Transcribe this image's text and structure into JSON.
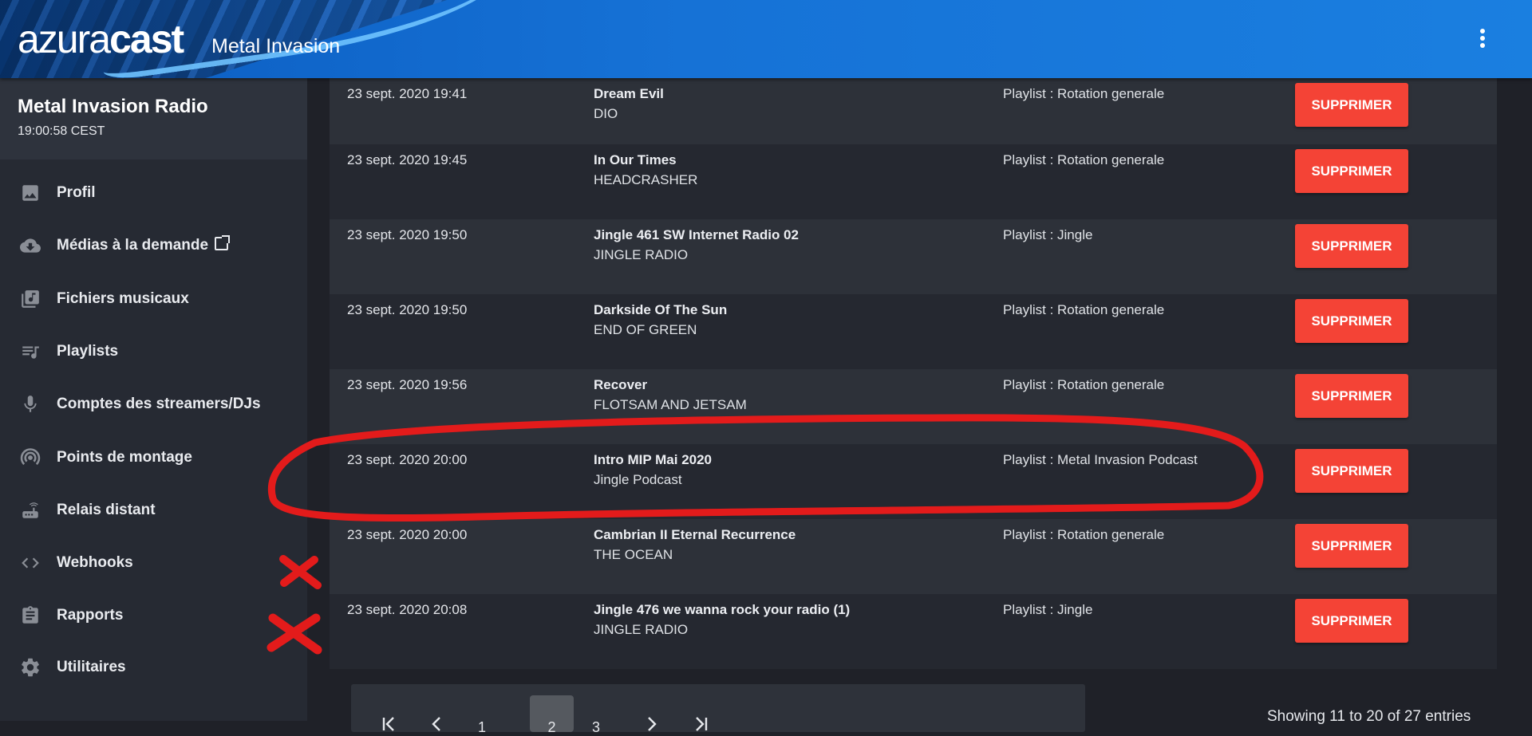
{
  "header": {
    "logo_light": "azura",
    "logo_bold": "cast",
    "station_title": "Metal Invasion"
  },
  "sidebar": {
    "station_name": "Metal Invasion Radio",
    "station_time": "19:00:58 CEST",
    "items": [
      {
        "label": "Profil",
        "icon": "image-icon"
      },
      {
        "label": "Médias à la demande",
        "icon": "cloud-download-icon",
        "external": true
      },
      {
        "label": "Fichiers musicaux",
        "icon": "library-music-icon"
      },
      {
        "label": "Playlists",
        "icon": "queue-music-icon"
      },
      {
        "label": "Comptes des streamers/DJs",
        "icon": "mic-icon"
      },
      {
        "label": "Points de montage",
        "icon": "podcast-icon"
      },
      {
        "label": "Relais distant",
        "icon": "router-icon"
      },
      {
        "label": "Webhooks",
        "icon": "code-icon"
      },
      {
        "label": "Rapports",
        "icon": "assignment-icon"
      },
      {
        "label": "Utilitaires",
        "icon": "settings-icon"
      }
    ]
  },
  "queue": {
    "delete_label": "SUPPRIMER",
    "rows": [
      {
        "date": "23 sept. 2020 19:41",
        "title": "Dream Evil",
        "artist": "DIO",
        "playlist": "Playlist : Rotation generale"
      },
      {
        "date": "23 sept. 2020 19:45",
        "title": "In Our Times",
        "artist": "HEADCRASHER",
        "playlist": "Playlist : Rotation generale"
      },
      {
        "date": "23 sept. 2020 19:50",
        "title": "Jingle 461 SW Internet Radio 02",
        "artist": "JINGLE RADIO",
        "playlist": "Playlist : Jingle"
      },
      {
        "date": "23 sept. 2020 19:50",
        "title": "Darkside Of The Sun",
        "artist": "END OF GREEN",
        "playlist": "Playlist : Rotation generale"
      },
      {
        "date": "23 sept. 2020 19:56",
        "title": "Recover",
        "artist": "FLOTSAM AND JETSAM",
        "playlist": "Playlist : Rotation generale"
      },
      {
        "date": "23 sept. 2020 20:00",
        "title": "Intro MIP Mai 2020",
        "artist": "Jingle Podcast",
        "playlist": "Playlist : Metal Invasion Podcast"
      },
      {
        "date": "23 sept. 2020 20:00",
        "title": "Cambrian II Eternal Recurrence",
        "artist": "THE OCEAN",
        "playlist": "Playlist : Rotation generale"
      },
      {
        "date": "23 sept. 2020 20:08",
        "title": "Jingle 476 we wanna rock your radio (1)",
        "artist": "JINGLE RADIO",
        "playlist": "Playlist : Jingle"
      }
    ]
  },
  "pagination": {
    "pages": [
      "1",
      "2",
      "3"
    ],
    "current_page": "2",
    "entries_text": "Showing 11 to 20 of 27 entries"
  },
  "colors": {
    "header_blue": "#1672d6",
    "danger_red": "#f44336",
    "annotation_red": "#e31b1b"
  }
}
